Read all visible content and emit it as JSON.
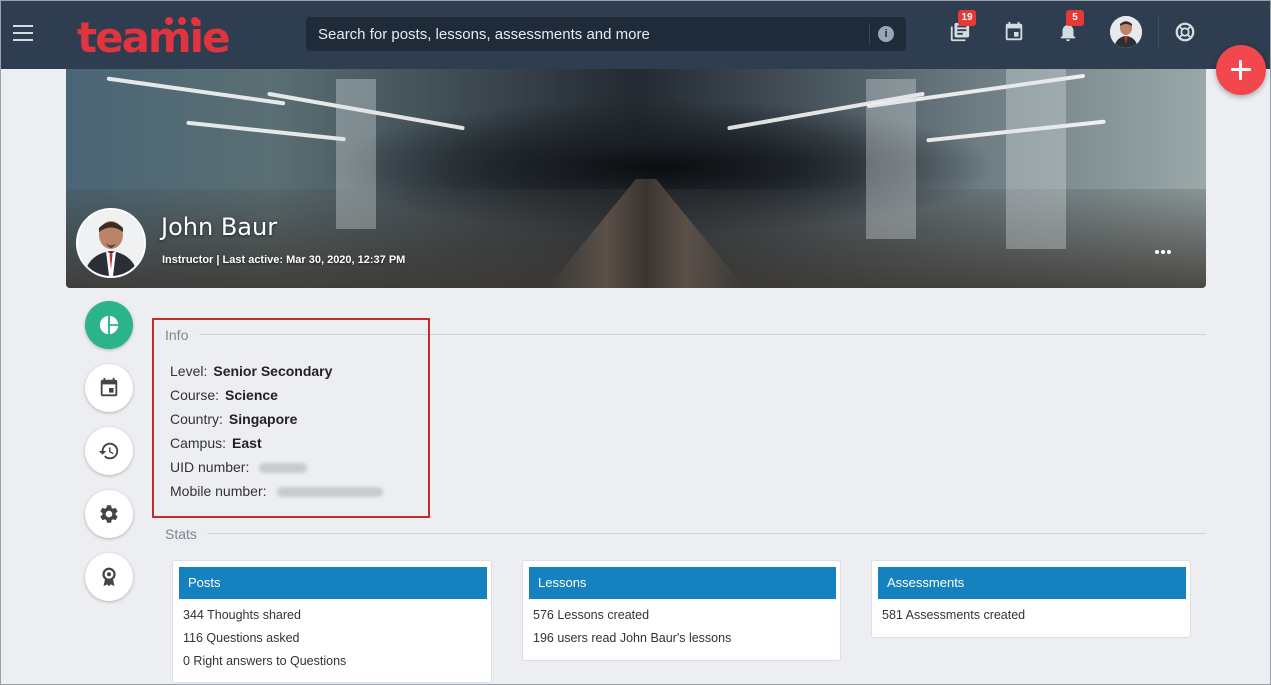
{
  "topbar": {
    "logo_text": "teamie",
    "search_placeholder": "Search for posts, lessons, assessments and more",
    "posts_badge": "19",
    "notifications_badge": "5"
  },
  "profile": {
    "name": "John Baur",
    "meta": "Instructor | Last active: Mar 30, 2020, 12:37 PM"
  },
  "info": {
    "heading": "Info",
    "rows": [
      {
        "label": "Level:",
        "value": "Senior Secondary"
      },
      {
        "label": "Course:",
        "value": "Science"
      },
      {
        "label": "Country:",
        "value": "Singapore"
      },
      {
        "label": "Campus:",
        "value": "East"
      },
      {
        "label": "UID number:",
        "value": ""
      },
      {
        "label": "Mobile number:",
        "value": ""
      }
    ]
  },
  "stats": {
    "heading": "Stats",
    "posts": {
      "title": "Posts",
      "lines": [
        "344 Thoughts shared",
        "116 Questions asked",
        "0 Right answers to Questions"
      ]
    },
    "lessons": {
      "title": "Lessons",
      "lines": [
        "576 Lessons created",
        "196 users read John Baur's lessons"
      ]
    },
    "assessments": {
      "title": "Assessments",
      "lines": [
        "581 Assessments created"
      ]
    }
  },
  "colors": {
    "topbar": "#2e3d4f",
    "brand_red": "#e0343e",
    "active_green": "#2bb389",
    "card_header_blue": "#1681bf",
    "highlight_box_red": "#c62b2b"
  }
}
